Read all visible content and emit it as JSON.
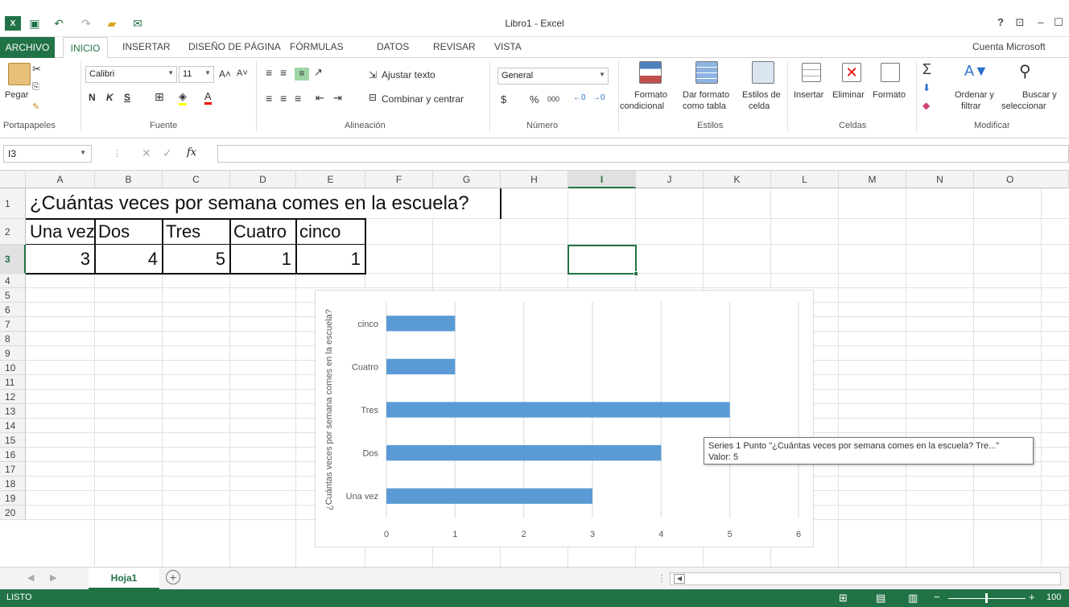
{
  "window": {
    "title": "Libro1 - Excel",
    "help": "?",
    "minimize": "–",
    "maximize": "☐"
  },
  "ribbon_tabs": [
    "ARCHIVO",
    "INICIO",
    "INSERTAR",
    "DISEÑO DE PÁGINA",
    "FÓRMULAS",
    "DATOS",
    "REVISAR",
    "VISTA"
  ],
  "account": "Cuenta Microsoft",
  "clipboard": {
    "paste": "Pegar",
    "label": "Portapapeles"
  },
  "font": {
    "name": "Calibri",
    "size": "11",
    "label": "Fuente",
    "bold": "N",
    "italic": "K",
    "underline": "S"
  },
  "alignment": {
    "wrap": "Ajustar texto",
    "merge": "Combinar y centrar",
    "label": "Alineación"
  },
  "number": {
    "format": "General",
    "label": "Número",
    "currency": "$",
    "percent": "%",
    "thousands": "000"
  },
  "styles": {
    "cond1": "Formato",
    "cond2": "condicional",
    "table1": "Dar formato",
    "table2": "como tabla",
    "cell1": "Estilos de",
    "cell2": "celda",
    "label": "Estilos"
  },
  "cells": {
    "insert": "Insertar",
    "delete": "Eliminar",
    "format": "Formato",
    "label": "Celdas"
  },
  "editing": {
    "sort1": "Ordenar y",
    "sort2": "filtrar",
    "find1": "Buscar y",
    "find2": "seleccionar",
    "label": "Modificar"
  },
  "formula_bar": {
    "name_box": "I3",
    "fx": "fx",
    "value": ""
  },
  "columns": [
    "A",
    "B",
    "C",
    "D",
    "E",
    "F",
    "G",
    "H",
    "I",
    "J",
    "K",
    "L",
    "M",
    "N",
    "O"
  ],
  "rows": [
    "1",
    "2",
    "3",
    "4",
    "5",
    "6",
    "7",
    "8",
    "9",
    "10",
    "11",
    "12",
    "13",
    "14",
    "15",
    "16",
    "17",
    "18",
    "19",
    "20"
  ],
  "sheet": {
    "A1": "¿Cuántas veces por semana comes en la escuela?",
    "A2": "Una vez",
    "B2": "Dos",
    "C2": "Tres",
    "D2": "Cuatro",
    "E2": "cinco",
    "A3": "3",
    "B3": "4",
    "C3": "5",
    "D3": "1",
    "E3": "1"
  },
  "chart_data": {
    "type": "bar",
    "orientation": "horizontal",
    "categories": [
      "Una vez",
      "Dos",
      "Tres",
      "Cuatro",
      "cinco"
    ],
    "values": [
      3,
      4,
      5,
      1,
      1
    ],
    "ylabel": "¿Cuántas veces por semana comes en la escuela?",
    "xlim": [
      0,
      6
    ],
    "xticks": [
      0,
      1,
      2,
      3,
      4,
      5,
      6
    ],
    "grid": true,
    "bar_color": "#5b9bd5"
  },
  "tooltip": {
    "line1": "Series 1 Punto \"¿Cuántas veces por semana comes en la escuela? Tre...\"",
    "line2": "Valor: 5"
  },
  "sheet_tabs": {
    "active": "Hoja1",
    "add": "+"
  },
  "status": {
    "mode": "LISTO",
    "zoom": "100"
  },
  "colors": {
    "accent": "#217346",
    "selection": "#217346"
  }
}
